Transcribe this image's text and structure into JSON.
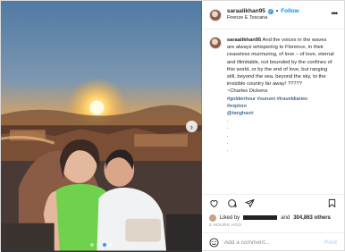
{
  "header": {
    "username": "saraalikhan95",
    "verified_mark": "✓",
    "separator": "•",
    "follow_label": "Follow",
    "location": "Firenze E Toscana",
    "more_icon": "ellipsis-icon"
  },
  "caption": {
    "username": "saraalikhan95",
    "lines": [
      "And the voices in the",
      "waves are always whispering to",
      "Florence, in their ceaseless",
      "murmuring, of love – of love, eternal",
      "and illimitable, not bounded by the",
      "confines of this world, or by the end",
      "of love, but ranging still, beyond the",
      "sea, beyond the sky, to the invisible",
      "country far away! ?????",
      "~Charles Dickens"
    ],
    "hashtags_1": "#goldenhour #sunset #traveldiaries",
    "hashtags_2": "#explore",
    "mention": "@tanghavri",
    "dots": [
      ".",
      ".",
      ".",
      ".",
      "."
    ]
  },
  "actions": {
    "like_icon": "heart-icon",
    "comment_icon": "comment-icon",
    "share_icon": "share-icon",
    "save_icon": "bookmark-icon"
  },
  "likes": {
    "prefix": "Liked by",
    "and": "and",
    "count": "304,863 others"
  },
  "timestamp": "2 HOURS AGO",
  "comment": {
    "placeholder": "Add a comment...",
    "post_label": "Post"
  },
  "carousel": {
    "next_icon": "chevron-right-icon",
    "next_glyph": "›",
    "dot_count": 4,
    "active_index": 2
  },
  "colors": {
    "link": "#0095f6",
    "hashtag": "#00376b",
    "verified": "#3897f0"
  }
}
